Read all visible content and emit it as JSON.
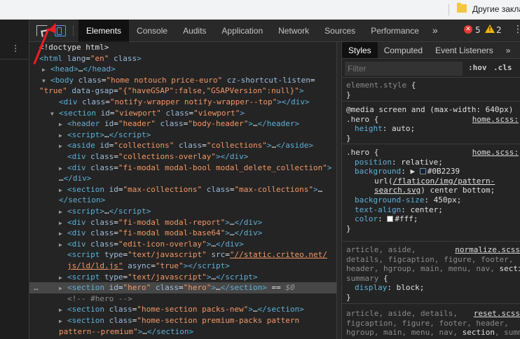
{
  "bookmarks": {
    "folder_label": "Другие закла"
  },
  "toolbar": {
    "tabs": [
      "Elements",
      "Console",
      "Audits",
      "Application",
      "Network",
      "Sources",
      "Performance"
    ],
    "more": "»",
    "errors": "5",
    "warnings": "2",
    "menu": "⋮"
  },
  "styles_tabs": [
    "Styles",
    "Computed",
    "Event Listeners",
    "»"
  ],
  "styles_filter": {
    "placeholder": "Filter",
    "hov": ":hov",
    "cls": ".cls"
  },
  "colors": {
    "accent_blue": "#4e9cf4",
    "tag": "#5db0d7",
    "attr_value": "#f29766",
    "arrow": "#ee1c24"
  }
}
